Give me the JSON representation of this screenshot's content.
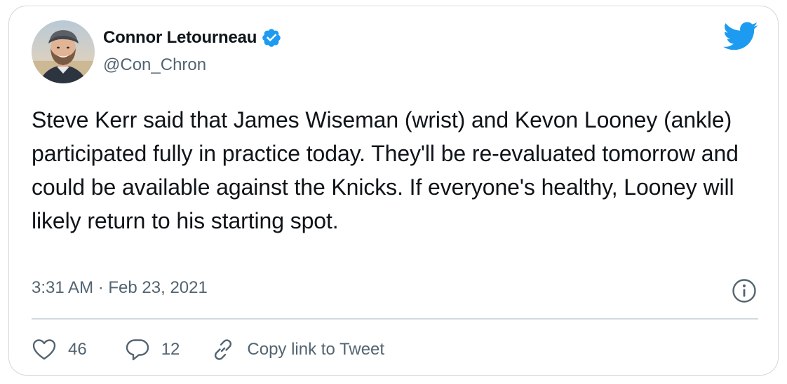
{
  "author": {
    "name": "Connor Letourneau",
    "handle": "@Con_Chron",
    "verified": true
  },
  "tweet": {
    "text": "Steve Kerr said that James Wiseman (wrist) and Kevon Looney (ankle) participated fully in practice today. They'll be re-evaluated tomorrow and could be available against the Knicks. If everyone's healthy, Looney will likely return to his starting spot.",
    "timestamp": "3:31 AM · Feb 23, 2021"
  },
  "actions": {
    "likes": "46",
    "replies": "12",
    "copy_link": "Copy link to Tweet"
  },
  "icons": {
    "brand": "twitter-bird-icon",
    "verified": "verified-badge-icon",
    "info": "info-icon",
    "like": "heart-icon",
    "reply": "reply-icon",
    "link": "link-icon"
  },
  "colors": {
    "brand_blue": "#1d9bf0",
    "text": "#0f1419",
    "secondary": "#536471",
    "border": "#cfd9de"
  }
}
